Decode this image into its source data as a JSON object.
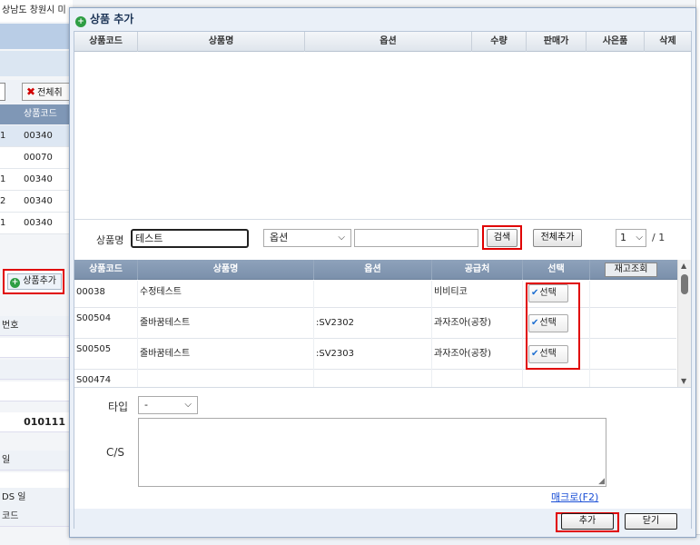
{
  "background": {
    "address_fragment": "상남도 창원시 미",
    "all_cancel_label": "전체취",
    "product_code_header": "상품코드",
    "rows": [
      {
        "mark": "1",
        "code": "00340"
      },
      {
        "mark": "",
        "code": "00070"
      },
      {
        "mark": "1",
        "code": "00340"
      },
      {
        "mark": "2",
        "code": "00340"
      },
      {
        "mark": "1",
        "code": "00340"
      }
    ],
    "add_goods_label": "상품추가",
    "label_number": "번호",
    "value_number": "010111",
    "label_day": "일",
    "label_ds_day": "DS 일",
    "label_code": "코드"
  },
  "dialog": {
    "title": "상품 추가",
    "selected_table": {
      "headers": [
        "상품코드",
        "상품명",
        "옵션",
        "수량",
        "판매가",
        "사은품",
        "삭제"
      ]
    },
    "search": {
      "product_name_label": "상품명",
      "product_name_value": "테스트",
      "option_select": "옵션",
      "option_text_value": "",
      "search_button": "검색",
      "add_all_button": "전체추가",
      "page_current": "1",
      "page_total": "/ 1"
    },
    "results_table": {
      "headers": [
        "상품코드",
        "상품명",
        "옵션",
        "공급처",
        "선택"
      ],
      "stock_button": "재고조회",
      "rows": [
        {
          "code": "00038",
          "name": "수정테스트",
          "option": "",
          "supplier": "비비티코",
          "select": "선택"
        },
        {
          "code": "S00504",
          "name": "줄바꿈테스트",
          "option": ":SV2302",
          "supplier": "과자조아(공장)",
          "select": "선택"
        },
        {
          "code": "S00505",
          "name": "줄바꿈테스트",
          "option": ":SV2303",
          "supplier": "과자조아(공장)",
          "select": "선택"
        },
        {
          "code": "S00474",
          "name": "",
          "option": "",
          "supplier": "",
          "select": ""
        }
      ]
    },
    "type_label": "타입",
    "type_value": "-",
    "cs_label": "C/S",
    "macro_link": "매크로(F2)",
    "add_button": "추가",
    "close_button": "닫기"
  },
  "colors": {
    "highlight": "#e00000",
    "header_bg": "#dfe5ec",
    "link": "#1a4fd6",
    "check": "#1f6fd1"
  }
}
